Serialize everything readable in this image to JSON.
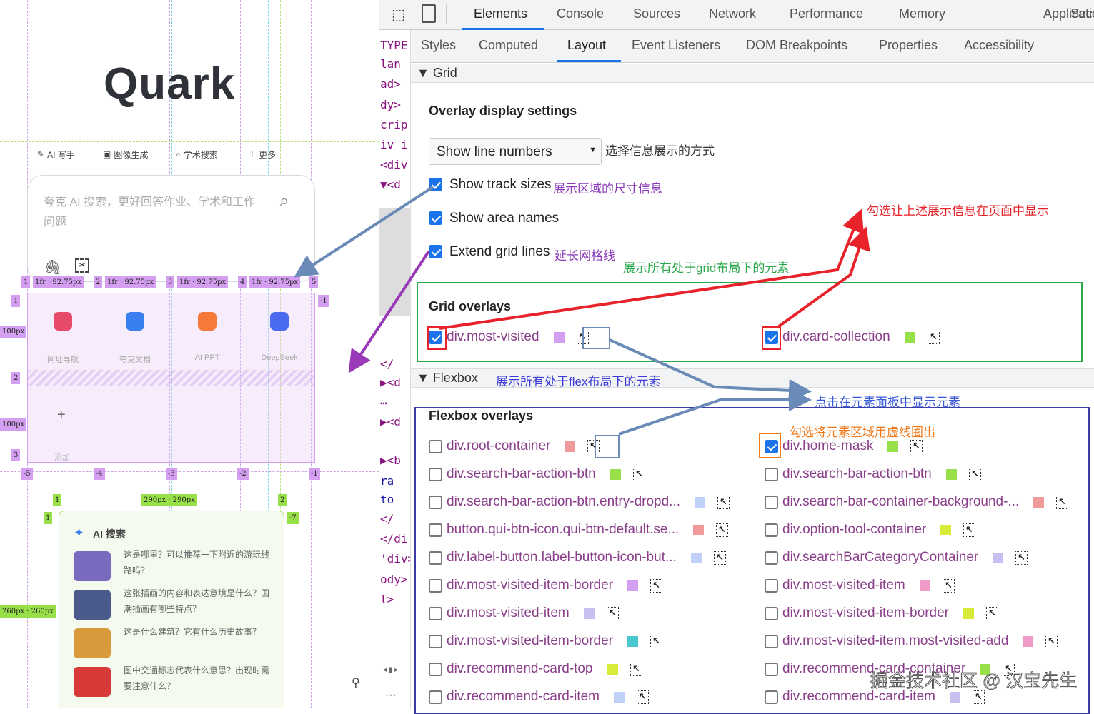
{
  "page": {
    "logo": "Quark",
    "nav": [
      {
        "icon": "pen-icon",
        "glyph": "✎",
        "label": "AI 写手"
      },
      {
        "icon": "image-icon",
        "glyph": "▣",
        "label": "图像生成"
      },
      {
        "icon": "academic-icon",
        "glyph": "⌕",
        "label": "学术搜索"
      },
      {
        "icon": "more-icon",
        "glyph": "⁘",
        "label": "更多"
      }
    ],
    "search_placeholder": "夸克 AI 搜索，更好回答作业、学术和工作问题",
    "col_labels": [
      "1",
      "1fr · 92.75px",
      "2",
      "1fr · 92.75px",
      "3",
      "1fr · 92.75px",
      "4",
      "1fr · 92.75px",
      "5"
    ],
    "row_labels": [
      "1",
      "100px",
      "2",
      "100px",
      "3"
    ],
    "neg_col_labels": [
      "-5",
      "-4",
      "-3",
      "-2",
      "-1"
    ],
    "neg_row_label": "-1",
    "most_visited": [
      {
        "label": "网址导航",
        "color": "#e84a6a"
      },
      {
        "label": "夸克文档",
        "color": "#3a7ff0"
      },
      {
        "label": "AI PPT",
        "color": "#f57a3a"
      },
      {
        "label": "DeepSeek",
        "color": "#4a6af0"
      }
    ],
    "add_glyph": "+",
    "add_label": "添加",
    "green_col_labels": [
      "1",
      "290px · 290px",
      "2"
    ],
    "green_row_labels": [
      "1",
      "-7",
      "260px · 260px"
    ],
    "card_title": "AI 搜索",
    "card_items": [
      {
        "text": "这是哪里？可以推荐一下附近的游玩线路吗？",
        "color": "#7a6ac0"
      },
      {
        "text": "这张插画的内容和表达意境是什么？国潮插画有哪些特点？",
        "color": "#4a5a8a"
      },
      {
        "text": "这是什么建筑？它有什么历史故事？",
        "color": "#d89a3a"
      },
      {
        "text": "图中交通标志代表什么意思？出现时需要注意什么？",
        "color": "#d83a3a"
      }
    ]
  },
  "dom_lines": [
    "TYPE",
    "lan",
    "ad>",
    "dy>",
    "crip",
    "iv i",
    "<div",
    "▼<d",
    "</",
    "▶<d",
    "⋯",
    "▶<d",
    "▶<b",
    "ra",
    "to",
    "</",
    "</di",
    "'div>",
    "ody>",
    "l>"
  ],
  "devtools": {
    "main_tabs": [
      "Elements",
      "Console",
      "Sources",
      "Network",
      "Performance",
      "Memory",
      "Application",
      "Sec"
    ],
    "sub_tabs": [
      "Styles",
      "Computed",
      "Layout",
      "Event Listeners",
      "DOM Breakpoints",
      "Properties",
      "Accessibility"
    ],
    "grid_section": "▼ Grid",
    "overlay_title": "Overlay display settings",
    "select_value": "Show line numbers",
    "options": [
      {
        "label": "Show track sizes",
        "checked": true
      },
      {
        "label": "Show area names",
        "checked": true
      },
      {
        "label": "Extend grid lines",
        "checked": true
      }
    ],
    "grid_overlays_title": "Grid overlays",
    "grid_overlays": [
      {
        "label": "div.most-visited",
        "checked": true,
        "color": "#d49ff0"
      },
      {
        "label": "div.card-collection",
        "checked": true,
        "color": "#98e04a"
      }
    ],
    "flex_section": "▼ Flexbox",
    "flex_overlays_title": "Flexbox overlays",
    "flex_left": [
      {
        "label": "div.root-container",
        "color": "#f09a9a",
        "checked": false
      },
      {
        "label": "div.search-bar-action-btn",
        "color": "#98e04a",
        "checked": false
      },
      {
        "label": "div.search-bar-action-btn.entry-dropd...",
        "color": "#c0d0f8",
        "checked": false
      },
      {
        "label": "button.qui-btn-icon.qui-btn-default.se...",
        "color": "#f09a9a",
        "checked": false
      },
      {
        "label": "div.label-button.label-button-icon-but...",
        "color": "#c0d0f8",
        "checked": false
      },
      {
        "label": "div.most-visited-item-border",
        "color": "#d49ff0",
        "checked": false
      },
      {
        "label": "div.most-visited-item",
        "color": "#c8c0f0",
        "checked": false
      },
      {
        "label": "div.most-visited-item-border",
        "color": "#4ac8d0",
        "checked": false
      },
      {
        "label": "div.recommend-card-top",
        "color": "#d8ea3a",
        "checked": false
      },
      {
        "label": "div.recommend-card-item",
        "color": "#c0d0f8",
        "checked": false
      }
    ],
    "flex_right": [
      {
        "label": "div.home-mask",
        "color": "#98e04a",
        "checked": true
      },
      {
        "label": "div.search-bar-action-btn",
        "color": "#98e04a",
        "checked": false
      },
      {
        "label": "div.search-bar-container-background-...",
        "color": "#f09a9a",
        "checked": false
      },
      {
        "label": "div.option-tool-container",
        "color": "#d8ea3a",
        "checked": false
      },
      {
        "label": "div.searchBarCategoryContainer",
        "color": "#c8c0f0",
        "checked": false
      },
      {
        "label": "div.most-visited-item",
        "color": "#f09ac8",
        "checked": false
      },
      {
        "label": "div.most-visited-item-border",
        "color": "#d8ea3a",
        "checked": false
      },
      {
        "label": "div.most-visited-item.most-visited-add",
        "color": "#f09ac8",
        "checked": false
      },
      {
        "label": "div.recommend-card-container",
        "color": "#98e04a",
        "checked": false
      },
      {
        "label": "div.recommend-card-item",
        "color": "#c8c0f0",
        "checked": false
      }
    ]
  },
  "annotations": {
    "select": "选择信息展示的方式",
    "track_sizes": "展示区域的尺寸信息",
    "extend_lines": "延长网格线",
    "grid_elements": "展示所有处于grid布局下的元素",
    "check_show": "勾选让上述展示信息在页面中显示",
    "flex_elements": "展示所有处于flex布局下的元素",
    "reveal": "点击在元素面板中显示元素",
    "dashed": "勾选将元素区域用虚线圈出"
  },
  "watermark": "掘金技术社区 @ 汉宝先生",
  "colors": {
    "accent": "#1a73e8",
    "grid_label": "#d49ff0",
    "flex_label": "#98e04a",
    "red": "#e8222a",
    "green": "#2aa84a",
    "blue": "#3a3aa8",
    "orange": "#f07a1a",
    "purple": "#8a3ab8"
  }
}
